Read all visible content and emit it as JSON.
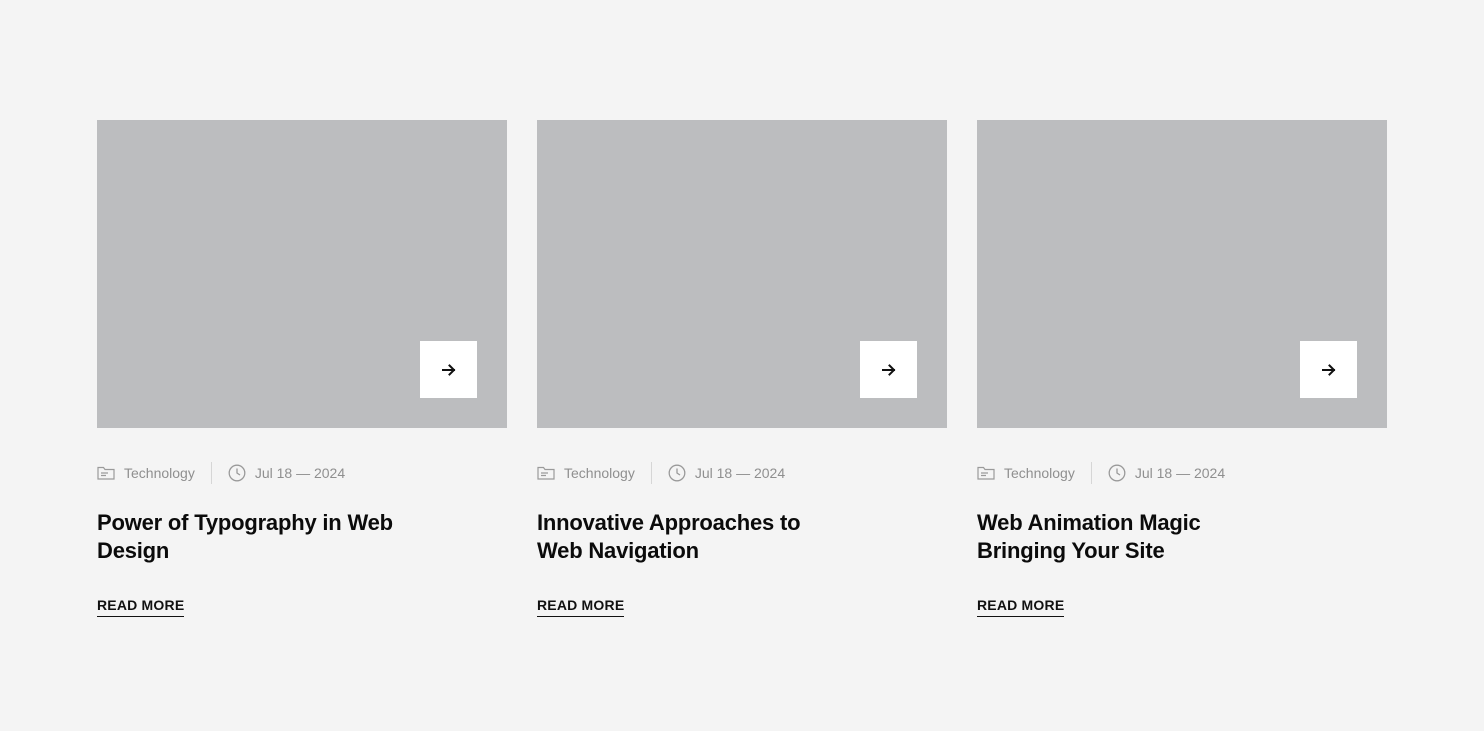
{
  "posts": [
    {
      "category": "Technology",
      "date": "Jul 18 — 2024",
      "title": "Power of Typography in Web Design",
      "read_more": "READ MORE"
    },
    {
      "category": "Technology",
      "date": "Jul 18 — 2024",
      "title": "Innovative Approaches to Web Navigation",
      "read_more": "READ MORE"
    },
    {
      "category": "Technology",
      "date": "Jul 18 — 2024",
      "title": "Web Animation Magic Bringing Your Site",
      "read_more": "READ MORE"
    }
  ],
  "icons": {
    "arrow": "arrow-right-icon",
    "category": "folder-icon",
    "date": "clock-icon"
  },
  "colors": {
    "background": "#f4f4f4",
    "thumbnail": "#bcbdbf",
    "meta_text": "#8f8f8f",
    "title_text": "#0b0b0b"
  }
}
